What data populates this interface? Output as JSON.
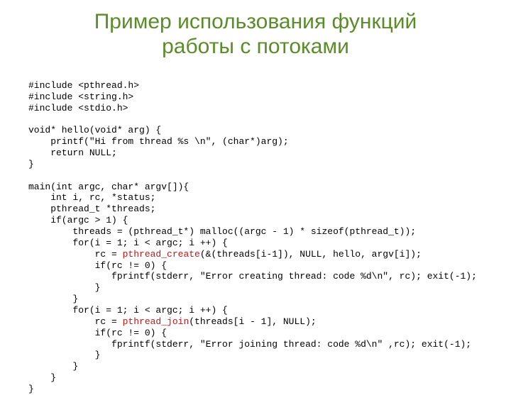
{
  "title": "Пример использования функций\nработы с потоками",
  "code": {
    "l1": "#include <pthread.h>",
    "l2": "#include <string.h>",
    "l3": "#include <stdio.h>",
    "l4": "",
    "l5": "void* hello(void* arg) {",
    "l6": "    printf(\"Hi from thread %s \\n\", (char*)arg);",
    "l7": "    return NULL;",
    "l8": "}",
    "l9": "",
    "l10": "main(int argc, char* argv[]){",
    "l11": "    int i, rc, *status;",
    "l12": "    pthread_t *threads;",
    "l13": "    if(argc > 1) {",
    "l14": "        threads = (pthread_t*) malloc((argc - 1) * sizeof(pthread_t));",
    "l15": "        for(i = 1; i < argc; i ++) {",
    "l16a": "            rc = ",
    "l16b": "pthread_create",
    "l16c": "(&(threads[i-1]), NULL, hello, argv[i]);",
    "l17": "            if(rc != 0) {",
    "l18": "               fprintf(stderr, \"Error creating thread: code %d\\n\", rc); exit(-1);",
    "l19": "            }",
    "l20": "        }",
    "l21": "        for(i = 1; i < argc; i ++) {",
    "l22a": "            rc = ",
    "l22b": "pthread_join",
    "l22c": "(threads[i - 1], NULL);",
    "l23": "            if(rc != 0) {",
    "l24": "               fprintf(stderr, \"Error joining thread: code %d\\n\" ,rc); exit(-1);",
    "l25": "            }",
    "l26": "        }",
    "l27": "    }",
    "l28": "}"
  }
}
